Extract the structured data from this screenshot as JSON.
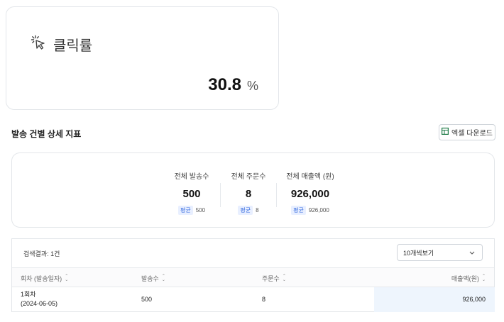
{
  "click_card": {
    "title": "클릭률",
    "value": "30.8",
    "unit": "%"
  },
  "section": {
    "title": "발송 건별 상세 지표",
    "excel_button": "엑셀 다운로드"
  },
  "summary": {
    "avg_tag": "평균",
    "stats": [
      {
        "label": "전체 발송수",
        "value": "500",
        "avg": "500"
      },
      {
        "label": "전체 주문수",
        "value": "8",
        "avg": "8"
      },
      {
        "label": "전체 매출액 (원)",
        "value": "926,000",
        "avg": "926,000"
      }
    ]
  },
  "table": {
    "result_count": "검색결과: 1건",
    "page_size": "10개씩보기",
    "columns": [
      "회차 (발송일자)",
      "발송수",
      "주문수",
      "매출액(원)"
    ],
    "rows": [
      {
        "round": "1회차",
        "date": "(2024-06-05)",
        "sent": "500",
        "orders": "8",
        "revenue": "926,000"
      }
    ]
  },
  "colors": {
    "accent": "#3b6fe0",
    "excel_green": "#1d7a46",
    "highlight": "#eef5fd"
  }
}
